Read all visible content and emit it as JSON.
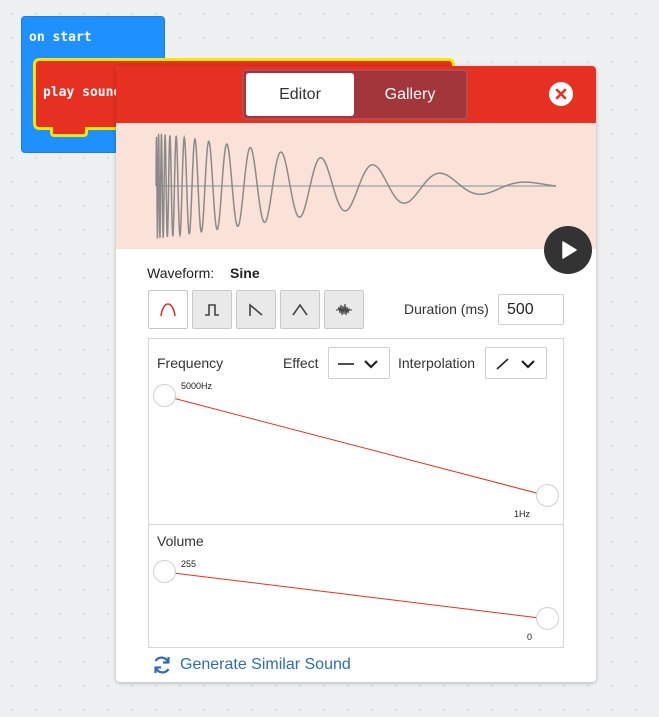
{
  "workspace": {
    "on_start_label": "on start",
    "play_sound_label": "play sound"
  },
  "dialog": {
    "tabs": {
      "editor": "Editor",
      "gallery": "Gallery",
      "active": "Editor"
    },
    "waveform": {
      "label": "Waveform:",
      "value": "Sine",
      "types": [
        "sine-icon",
        "square-icon",
        "sawtooth-icon",
        "triangle-icon",
        "noise-icon"
      ],
      "selected_index": 0
    },
    "duration": {
      "label": "Duration (ms)",
      "value": "500"
    },
    "frequency": {
      "title": "Frequency",
      "effect_label": "Effect",
      "interpolation_label": "Interpolation",
      "start_value": "5000Hz",
      "end_value": "1Hz"
    },
    "volume": {
      "title": "Volume",
      "start_value": "255",
      "end_value": "0"
    },
    "generate_label": "Generate Similar Sound"
  },
  "colors": {
    "header_red": "#e63022",
    "wave_bg": "#fbe2d9",
    "accent_blue": "#2f6db0",
    "block_blue": "#1e90ff",
    "highlight_yellow": "#f5e700"
  }
}
